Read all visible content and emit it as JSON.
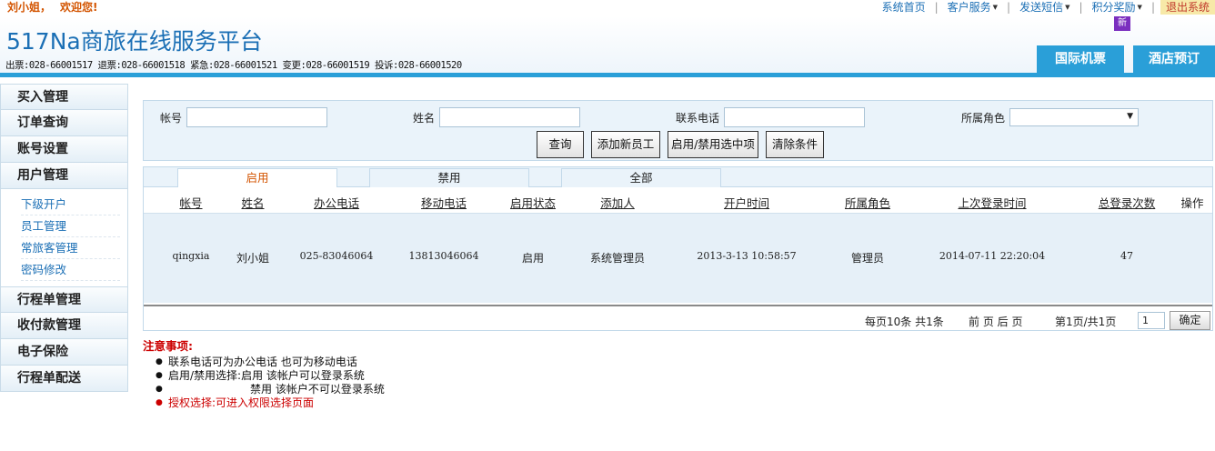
{
  "topbar": {
    "user": "刘小姐，",
    "welcome": "欢迎您!",
    "nav": [
      "系统首页",
      "客户服务",
      "发送短信",
      "积分奖励"
    ],
    "logout": "退出系统"
  },
  "header": {
    "brand": "517Na商旅在线服务平台",
    "phones": "出票:028-66001517 退票:028-66001518 紧急:028-66001521 变更:028-66001519 投诉:028-66001520",
    "new_badge": "新",
    "tab_intl": "国际机票",
    "tab_hotel": "酒店预订"
  },
  "sidebar": {
    "items_top": [
      "买入管理",
      "订单查询",
      "账号设置",
      "用户管理"
    ],
    "sub_items": [
      "下级开户",
      "员工管理",
      "常旅客管理",
      "密码修改"
    ],
    "items_bottom": [
      "行程单管理",
      "收付款管理",
      "电子保险",
      "行程单配送"
    ]
  },
  "search": {
    "account_label": "帐号",
    "name_label": "姓名",
    "phone_label": "联系电话",
    "role_label": "所属角色",
    "query_btn": "查询",
    "add_btn": "添加新员工",
    "toggle_btn": "启用/禁用选中项",
    "clear_btn": "清除条件"
  },
  "filter_tabs": [
    "启用",
    "禁用",
    "全部"
  ],
  "table": {
    "headers": [
      "帐号",
      "姓名",
      "办公电话",
      "移动电话",
      "启用状态",
      "添加人",
      "开户时间",
      "所属角色",
      "上次登录时间",
      "总登录次数",
      "操作"
    ],
    "rows": [
      [
        "qingxia",
        "刘小姐",
        "025-83046064",
        "13813046064",
        "启用",
        "系统管理员",
        "2013-3-13 10:58:57",
        "管理员",
        "2014-07-11 22:20:04",
        "47",
        ""
      ]
    ]
  },
  "pager": {
    "summary": "每页10条 共1条",
    "nav": "前 页 后 页",
    "page_info": "第1页/共1页",
    "page_value": "1",
    "confirm": "确定"
  },
  "notes": {
    "title": "注意事项:",
    "items": [
      "联系电话可为办公电话 也可为移动电话",
      "启用/禁用选择:启用 该帐户可以登录系统",
      "禁用 该帐户不可以登录系统",
      "授权选择:可进入权限选择页面"
    ]
  }
}
